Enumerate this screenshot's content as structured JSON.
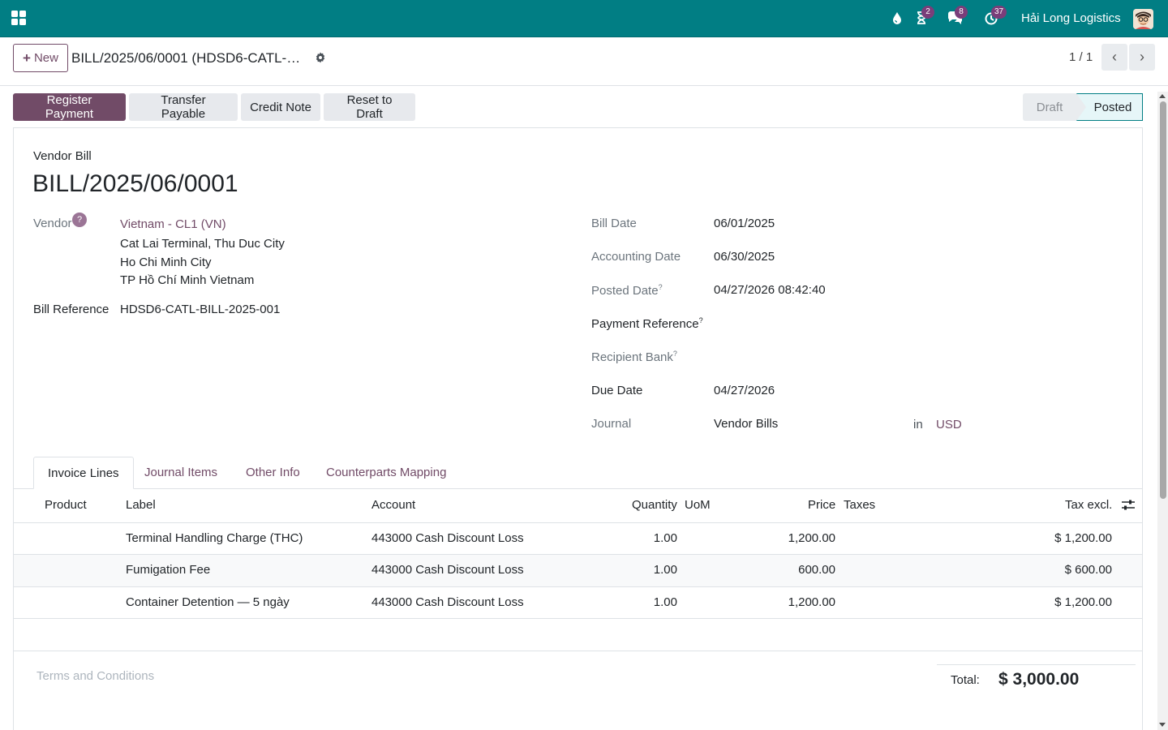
{
  "navbar": {
    "company": "Hải Long Logistics",
    "badges": {
      "activities": "2",
      "messages": "8",
      "timer": "37"
    }
  },
  "control": {
    "new_label": "New",
    "breadcrumb": "BILL/2025/06/0001 (HDSD6-CATL-…",
    "pager": "1 / 1"
  },
  "actions": {
    "register_payment": "Register Payment",
    "transfer_payable": "Transfer Payable",
    "credit_note": "Credit Note",
    "reset_to_draft": "Reset to Draft"
  },
  "status": {
    "draft": "Draft",
    "posted": "Posted"
  },
  "form": {
    "doc_type": "Vendor Bill",
    "name": "BILL/2025/06/0001",
    "vendor_label": "Vendor",
    "vendor_name": "Vietnam - CL1 (VN)",
    "vendor_address": [
      "Cat Lai Terminal, Thu Duc City",
      "Ho Chi Minh City",
      "TP Hồ Chí Minh Vietnam"
    ],
    "bill_reference_label": "Bill Reference",
    "bill_reference": "HDSD6-CATL-BILL-2025-001",
    "bill_date_label": "Bill Date",
    "bill_date": "06/01/2025",
    "accounting_date_label": "Accounting Date",
    "accounting_date": "06/30/2025",
    "posted_date_label": "Posted Date",
    "posted_date": "04/27/2026 08:42:40",
    "payment_reference_label": "Payment Reference",
    "recipient_bank_label": "Recipient Bank",
    "due_date_label": "Due Date",
    "due_date": "04/27/2026",
    "journal_label": "Journal",
    "journal": "Vendor Bills",
    "in_label": "in",
    "currency": "USD"
  },
  "tabs": [
    "Invoice Lines",
    "Journal Items",
    "Other Info",
    "Counterparts Mapping"
  ],
  "table": {
    "headers": {
      "product": "Product",
      "label": "Label",
      "account": "Account",
      "quantity": "Quantity",
      "uom": "UoM",
      "price": "Price",
      "taxes": "Taxes",
      "tax_excl": "Tax excl."
    },
    "rows": [
      {
        "label": "Terminal Handling Charge (THC)",
        "account": "443000 Cash Discount Loss",
        "quantity": "1.00",
        "price": "1,200.00",
        "subtotal": "$ 1,200.00"
      },
      {
        "label": "Fumigation Fee",
        "account": "443000 Cash Discount Loss",
        "quantity": "1.00",
        "price": "600.00",
        "subtotal": "$ 600.00"
      },
      {
        "label": "Container Detention — 5 ngày",
        "account": "443000 Cash Discount Loss",
        "quantity": "1.00",
        "price": "1,200.00",
        "subtotal": "$ 1,200.00"
      }
    ]
  },
  "footer": {
    "terms_placeholder": "Terms and Conditions",
    "total_label": "Total:",
    "total_value": "$ 3,000.00"
  }
}
